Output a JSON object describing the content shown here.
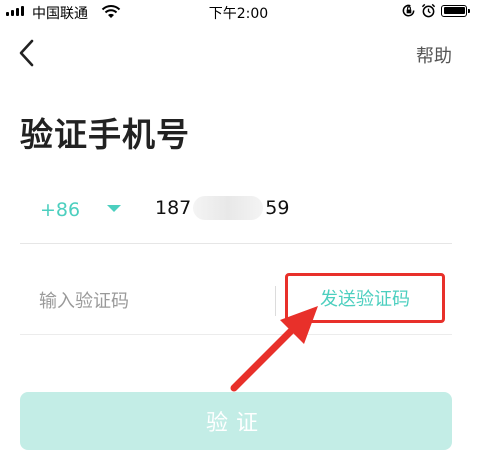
{
  "status_bar": {
    "carrier": "中国联通",
    "time": "下午2:00"
  },
  "nav": {
    "back_icon": "chevron-left-icon",
    "help_label": "帮助"
  },
  "title": "验证手机号",
  "phone": {
    "country_code": "+86",
    "number_prefix": "187",
    "number_suffix": "59"
  },
  "code": {
    "placeholder": "输入验证码",
    "value": "",
    "send_label": "发送验证码"
  },
  "verify_label": "验证",
  "colors": {
    "accent": "#4ccfbf",
    "annotation_red": "#e8302a",
    "button_disabled": "#c3ede6"
  }
}
